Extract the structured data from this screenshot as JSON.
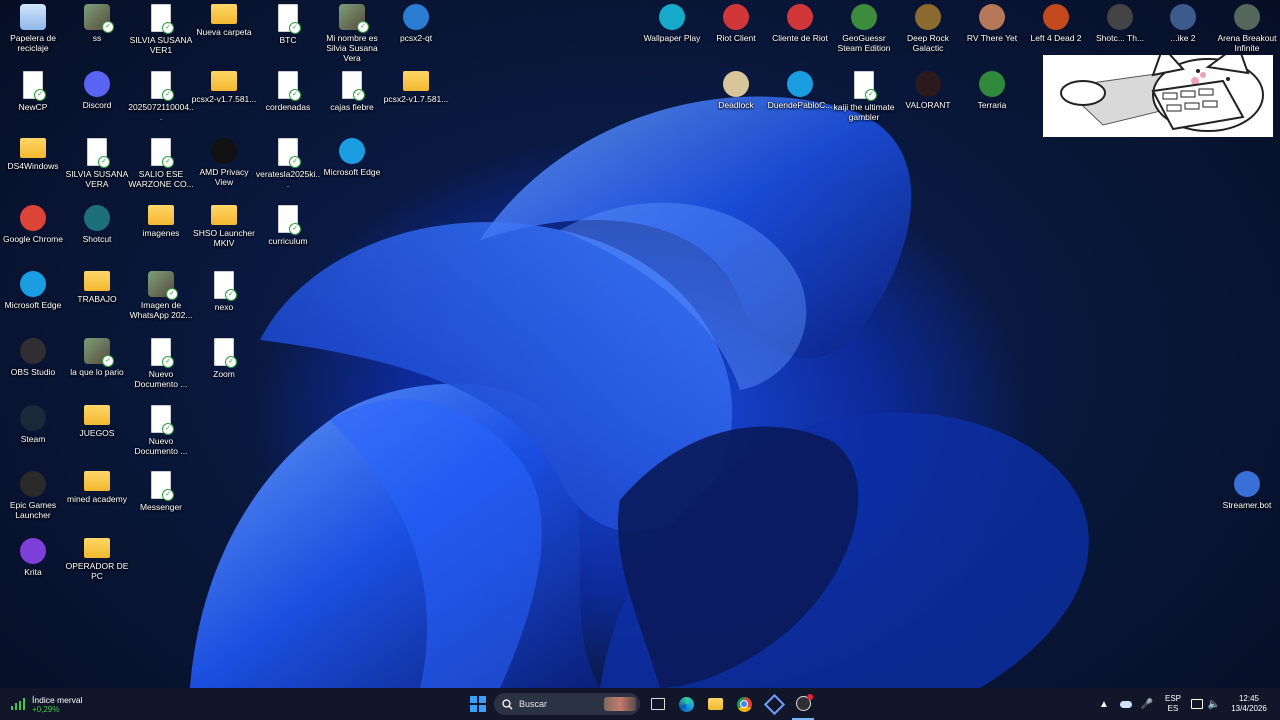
{
  "desktop_icons": [
    {
      "label": "Papelera de reciclaje",
      "icon": "recycle-bin-icon",
      "kind": "recycle"
    },
    {
      "label": "ss",
      "icon": "image-file-icon",
      "kind": "image"
    },
    {
      "label": "SILVIA SUSANA VER1",
      "icon": "document-icon",
      "kind": "file"
    },
    {
      "label": "Nueva carpeta",
      "icon": "folder-icon",
      "kind": "folder"
    },
    {
      "label": "BTC",
      "icon": "document-icon",
      "kind": "file"
    },
    {
      "label": "Mi nombre es Silvia Susana Vera",
      "icon": "image-file-icon",
      "kind": "image"
    },
    {
      "label": "pcsx2-qt",
      "icon": "pcsx2-icon",
      "kind": "app",
      "color": "#2b7cd3"
    },
    {
      "label": "NewCP",
      "icon": "document-icon",
      "kind": "file"
    },
    {
      "label": "Discord",
      "icon": "discord-icon",
      "kind": "app",
      "color": "#5865f2"
    },
    {
      "label": "2025072110004...",
      "icon": "document-icon",
      "kind": "file"
    },
    {
      "label": "pcsx2-v1.7.581...",
      "icon": "folder-icon",
      "kind": "folder"
    },
    {
      "label": "cordenadas",
      "icon": "document-icon",
      "kind": "file"
    },
    {
      "label": "cajas fiebre",
      "icon": "document-icon",
      "kind": "file"
    },
    {
      "label": "pcsx2-v1.7.581...",
      "icon": "folder-icon",
      "kind": "folder"
    },
    {
      "label": "DS4Windows",
      "icon": "folder-icon",
      "kind": "folder"
    },
    {
      "label": "SILVIA SUSANA VERA",
      "icon": "document-icon",
      "kind": "file"
    },
    {
      "label": "SALIO ESE WARZONE CO...",
      "icon": "document-icon",
      "kind": "file"
    },
    {
      "label": "AMD Privacy View",
      "icon": "amd-privacy-icon",
      "kind": "app",
      "color": "#111111"
    },
    {
      "label": "veratesla2025ki...",
      "icon": "document-icon",
      "kind": "file"
    },
    {
      "label": "Microsoft Edge",
      "icon": "edge-icon",
      "kind": "app",
      "color": "#1b9de2"
    },
    {
      "label": "Google Chrome",
      "icon": "chrome-icon",
      "kind": "app",
      "color": "#db4437"
    },
    {
      "label": "Shotcut",
      "icon": "shotcut-icon",
      "kind": "app",
      "color": "#1d6f7a"
    },
    {
      "label": "imagenes",
      "icon": "folder-icon",
      "kind": "folder"
    },
    {
      "label": "SHSO Launcher MKIV",
      "icon": "folder-icon",
      "kind": "folder"
    },
    {
      "label": "curriculum",
      "icon": "document-icon",
      "kind": "file"
    },
    {
      "label": "Microsoft Edge",
      "icon": "edge-icon",
      "kind": "app",
      "color": "#1b9de2"
    },
    {
      "label": "TRABAJO",
      "icon": "folder-icon",
      "kind": "folder"
    },
    {
      "label": "Imagen de WhatsApp 202...",
      "icon": "image-file-icon",
      "kind": "image"
    },
    {
      "label": "nexo",
      "icon": "document-icon",
      "kind": "file"
    },
    {
      "label": "OBS Studio",
      "icon": "obs-icon",
      "kind": "app",
      "color": "#302e31"
    },
    {
      "label": "la que lo pario",
      "icon": "image-file-icon",
      "kind": "image"
    },
    {
      "label": "Nuevo Documento ...",
      "icon": "document-icon",
      "kind": "file"
    },
    {
      "label": "Zoom",
      "icon": "document-icon",
      "kind": "file"
    },
    {
      "label": "Steam",
      "icon": "steam-icon",
      "kind": "app",
      "color": "#1b2838"
    },
    {
      "label": "JUEGOS",
      "icon": "folder-icon",
      "kind": "folder"
    },
    {
      "label": "Nuevo Documento ...",
      "icon": "document-icon",
      "kind": "file"
    },
    {
      "label": "Epic Games Launcher",
      "icon": "epic-games-icon",
      "kind": "app",
      "color": "#2a2a2a"
    },
    {
      "label": "mined academy",
      "icon": "folder-icon",
      "kind": "folder"
    },
    {
      "label": "Messenger",
      "icon": "document-icon",
      "kind": "file"
    },
    {
      "label": "Krita",
      "icon": "krita-icon",
      "kind": "app",
      "color": "#7e3fd8"
    },
    {
      "label": "OPERADOR DE PC",
      "icon": "folder-icon",
      "kind": "folder"
    },
    {
      "label": "Wallpaper Play",
      "icon": "wallpaper-play-icon",
      "kind": "app",
      "color": "#17a9c9"
    },
    {
      "label": "Riot Client",
      "icon": "riot-client-icon",
      "kind": "app",
      "color": "#d13639"
    },
    {
      "label": "Cliente de Riot",
      "icon": "riot-client-icon",
      "kind": "app",
      "color": "#d13639"
    },
    {
      "label": "GeoGuessr Steam Edition",
      "icon": "geoguessr-icon",
      "kind": "app",
      "color": "#3d8b3d"
    },
    {
      "label": "Deep Rock Galactic",
      "icon": "deep-rock-icon",
      "kind": "app",
      "color": "#8a6a2e"
    },
    {
      "label": "RV There Yet",
      "icon": "rv-there-yet-icon",
      "kind": "app",
      "color": "#b5795a"
    },
    {
      "label": "Left 4 Dead 2",
      "icon": "left4dead-icon",
      "kind": "app",
      "color": "#c24a1c"
    },
    {
      "label": "Shotc... Th...",
      "icon": "shotcut-icon",
      "kind": "app",
      "color": "#444444"
    },
    {
      "label": "...ike 2",
      "icon": "game-icon",
      "kind": "app",
      "color": "#3a5b8c"
    },
    {
      "label": "Arena Breakout Infinite",
      "icon": "arena-breakout-icon",
      "kind": "app",
      "color": "#55665a"
    },
    {
      "label": "Deadlock",
      "icon": "deadlock-icon",
      "kind": "app",
      "color": "#d8c59a"
    },
    {
      "label": "DuendePabloC...",
      "icon": "edge-icon",
      "kind": "app",
      "color": "#1b9de2"
    },
    {
      "label": "kaiji the ultimate gambler",
      "icon": "document-icon",
      "kind": "file"
    },
    {
      "label": "VALORANT",
      "icon": "valorant-icon",
      "kind": "app",
      "color": "#2a1a1e"
    },
    {
      "label": "Terraria",
      "icon": "terraria-icon",
      "kind": "app",
      "color": "#2f8a3c"
    },
    {
      "label": "Streamer.bot",
      "icon": "streamer-bot-icon",
      "kind": "app",
      "color": "#3b6fd8"
    }
  ],
  "widget": {
    "title": "Índice merval",
    "value": "+0,29%",
    "color": "#4cc24c"
  },
  "taskbar": {
    "search_placeholder": "Buscar",
    "language_top": "ESP",
    "language_bottom": "ES",
    "time": "12:45",
    "date": "13/4/2026"
  }
}
